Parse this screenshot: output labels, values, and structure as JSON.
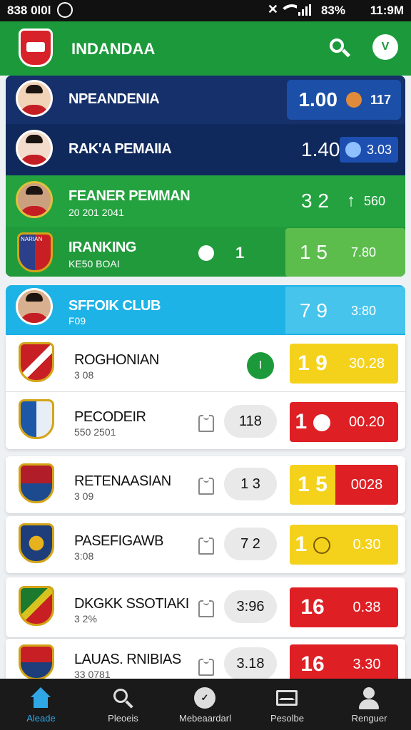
{
  "status_bar": {
    "left": "838 0l0l",
    "time": "11:9M",
    "battery": "83%"
  },
  "app": {
    "title": "INDANDAA",
    "avatar_letter": "V"
  },
  "top_rows": [
    {
      "name": "NPEANDENIA",
      "score": "1.00",
      "extra": "117"
    },
    {
      "name": "RAK'A PEMAIIA",
      "score": "1.40",
      "extra": "3.03"
    },
    {
      "name": "FEANER PEMMAN",
      "sub": "20 201 2041",
      "score": "3 2",
      "extra": "560"
    },
    {
      "name": "IRANKING",
      "sub": "KE50 BOAI",
      "mid": "1",
      "score": "1 5",
      "extra": "7.80",
      "crest_text": "NARIAN"
    }
  ],
  "club_header": {
    "name": "SFFOIK CLUB",
    "sub": "F09",
    "score": "7 9",
    "extra": "3:80"
  },
  "club_rows": [
    {
      "name": "ROGHONIAN",
      "sub": "3 08",
      "badge": "I",
      "odd1": "1 9",
      "odd2": "30.28",
      "c1": "#f4d21c",
      "c2": "#f4d21c"
    },
    {
      "name": "PECODEIR",
      "sub": "550 2501",
      "pill": "118",
      "odd1": "1",
      "odd2": "00.20",
      "c1": "#de1f24",
      "c2": "#de1f24"
    },
    {
      "name": "RETENAASIAN",
      "sub": "3 09",
      "pill": "1 3",
      "odd1": "1 5",
      "odd2": "0028",
      "c1": "#f4d21c",
      "c2": "#de1f24"
    },
    {
      "name": "PASEFIGAWB",
      "sub": "3:08",
      "pill": "7 2",
      "odd1": "1",
      "odd2": "0.30",
      "c1": "#f4d21c",
      "c2": "#f4d21c"
    },
    {
      "name": "DKGKK SSOTIAKI",
      "sub": "3 2%",
      "pill": "3:96",
      "odd1": "16",
      "odd2": "0.38",
      "c1": "#de1f24",
      "c2": "#de1f24"
    },
    {
      "name": "LAUAS. RNIBIAS",
      "sub": "33 0781",
      "pill": "3.18",
      "odd1": "16",
      "odd2": "3.30",
      "c1": "#de1f24",
      "c2": "#de1f24"
    }
  ],
  "nav": [
    {
      "label": "Aleade",
      "icon": "home-icon"
    },
    {
      "label": "Pleoeis",
      "icon": "search-icon"
    },
    {
      "label": "Mebeaardarl",
      "icon": "check-icon"
    },
    {
      "label": "Pesolbe",
      "icon": "mail-icon"
    },
    {
      "label": "Renguer",
      "icon": "user-icon"
    }
  ]
}
